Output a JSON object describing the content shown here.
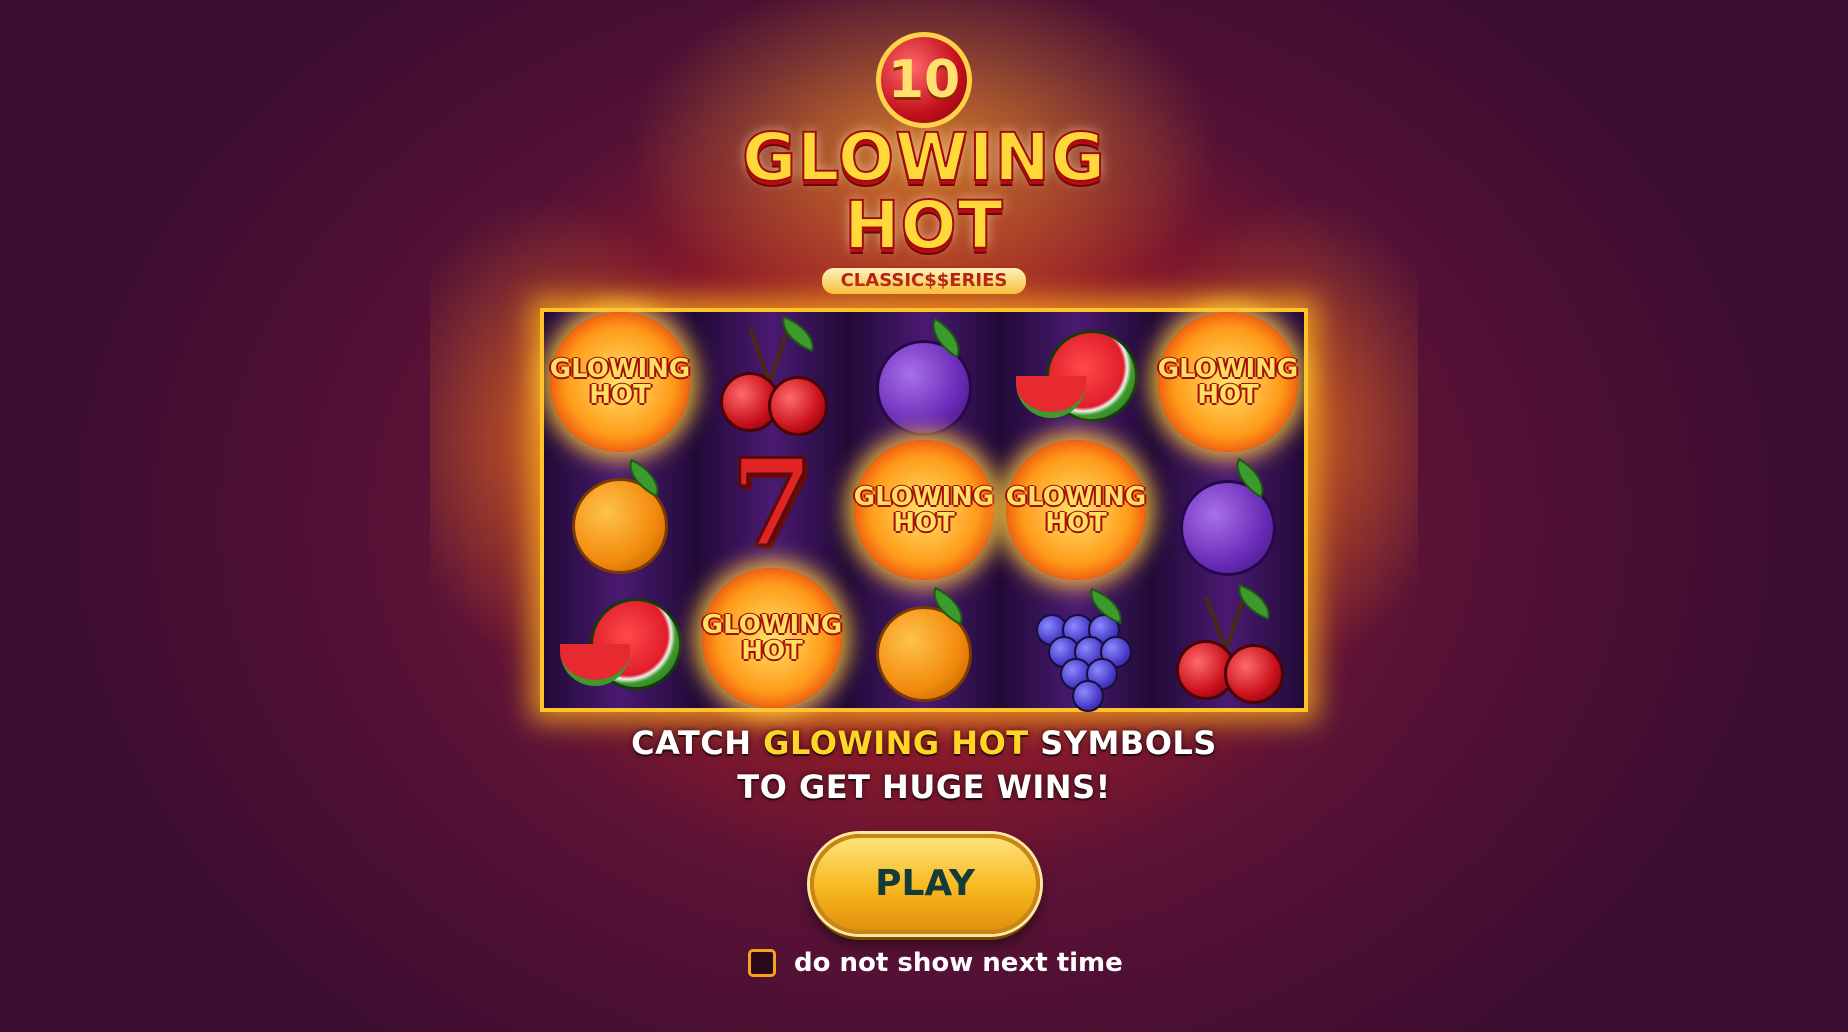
{
  "logo": {
    "number": "10",
    "title_line1": "GLOWING",
    "title_line2": "HOT",
    "series": "CLASSIC$$ERIES"
  },
  "reels": [
    [
      "glowing-hot",
      "orange",
      "watermelon"
    ],
    [
      "cherry",
      "seven",
      "glowing-hot"
    ],
    [
      "plum",
      "glowing-hot",
      "orange"
    ],
    [
      "watermelon",
      "glowing-hot",
      "grapes"
    ],
    [
      "glowing-hot",
      "plum",
      "cherry"
    ]
  ],
  "symbol_text": {
    "line1": "GLOWING",
    "line2": "HOT"
  },
  "caption": {
    "line1_prefix": "CATCH ",
    "line1_highlight": "GLOWING HOT",
    "line1_suffix": " SYMBOLS",
    "line2": "TO GET HUGE WINS!"
  },
  "play_button": {
    "label": "PLAY"
  },
  "dont_show": {
    "label": "do not show next time",
    "checked": false
  },
  "colors": {
    "accent_gold": "#ffd526",
    "frame": "#ffc22a",
    "background": "#5a1236"
  }
}
